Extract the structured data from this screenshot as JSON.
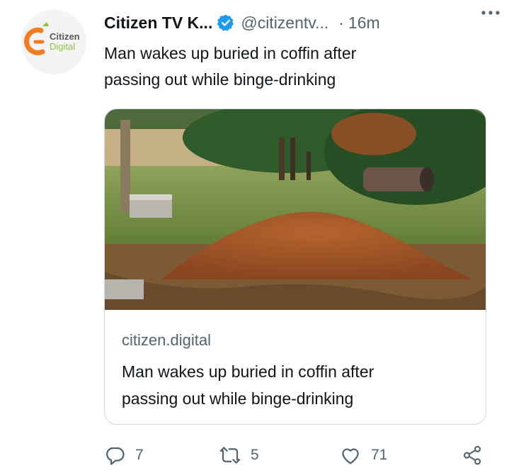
{
  "tweet": {
    "avatar": {
      "icon": "citizen-digital-logo",
      "logo_text_top": "Citizen",
      "logo_text_bottom": "Digital",
      "colors": {
        "orange": "#f47b20",
        "green": "#8cc63f",
        "gray": "#595959"
      }
    },
    "display_name": "Citizen TV K...",
    "verified_icon": "verified-badge-icon",
    "verified_color": "#1d9bf0",
    "handle": "@citizentv...",
    "separator": "·",
    "timestamp": "16m",
    "more_icon": "more-horizontal-icon",
    "text_lines": [
      "Man wakes up buried in coffin after",
      "passing out while binge-drinking"
    ]
  },
  "card": {
    "image_icon": "grave-mound-photo",
    "domain": "citizen.digital",
    "title_lines": [
      "Man wakes up buried in coffin after",
      "passing out while binge-drinking"
    ]
  },
  "actions": {
    "reply": {
      "icon": "reply-icon",
      "count": "7"
    },
    "retweet": {
      "icon": "retweet-icon",
      "count": "5"
    },
    "like": {
      "icon": "heart-icon",
      "count": "71"
    },
    "share": {
      "icon": "share-icon"
    }
  },
  "colors": {
    "text_primary": "#0f1419",
    "text_secondary": "#536471",
    "border": "#cfd9de"
  }
}
